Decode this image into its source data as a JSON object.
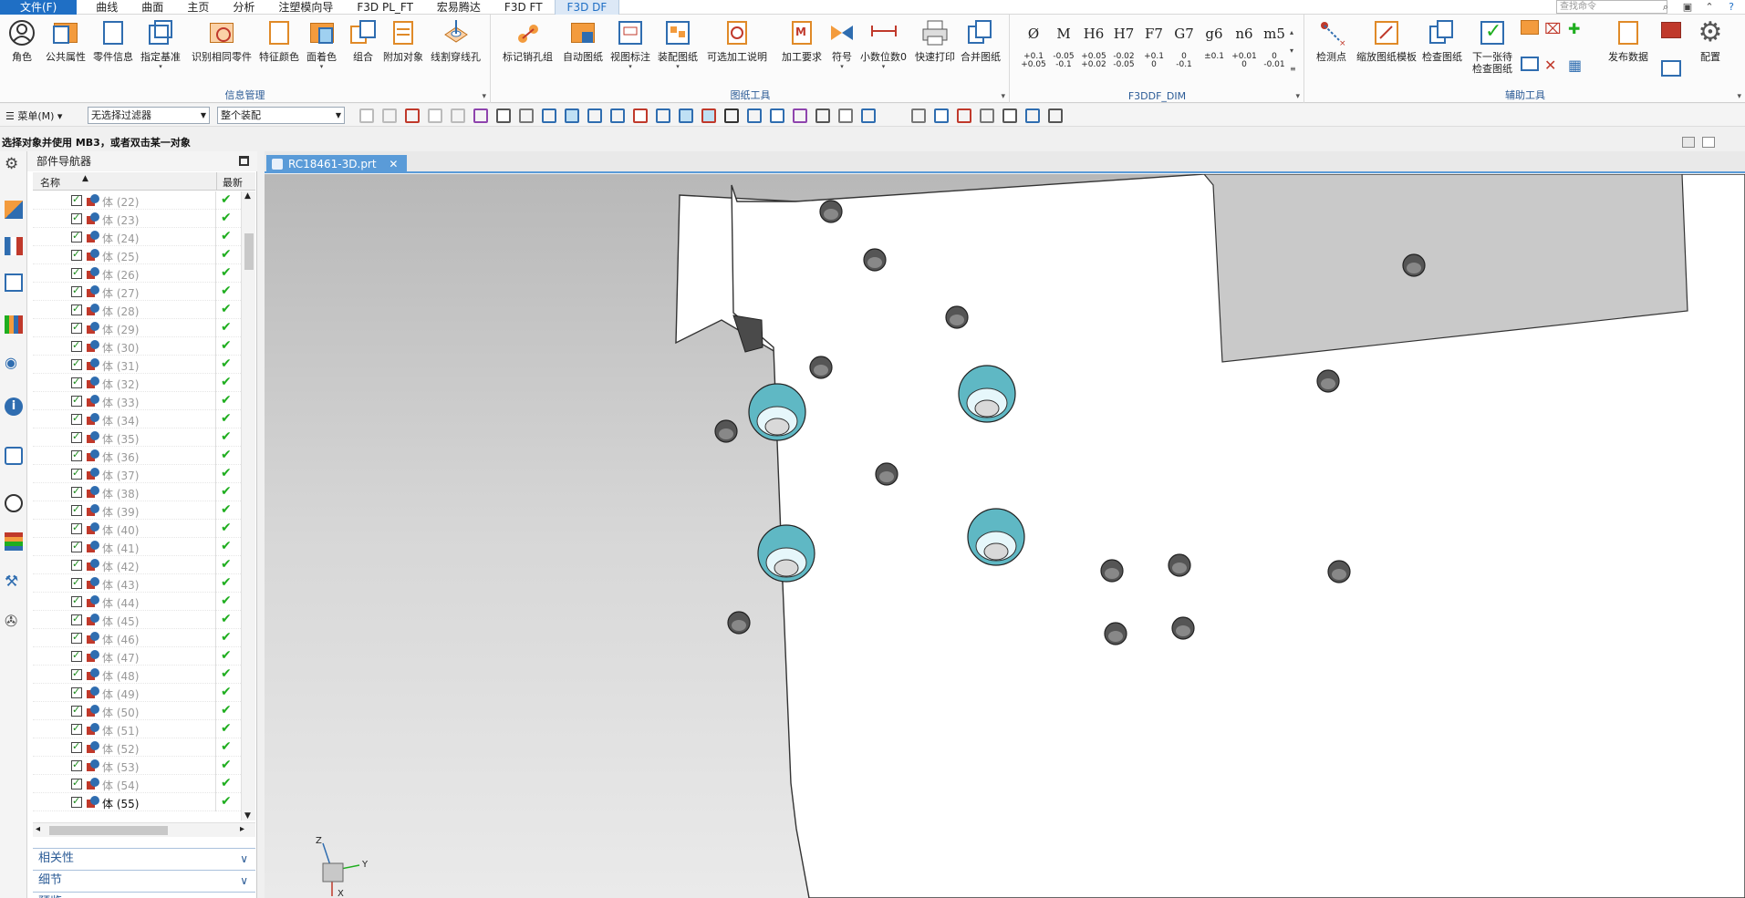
{
  "menu_tabs": [
    {
      "label": "文件(F)"
    },
    {
      "label": "曲线"
    },
    {
      "label": "曲面"
    },
    {
      "label": "主页"
    },
    {
      "label": "分析"
    },
    {
      "label": "注塑模向导"
    },
    {
      "label": "F3D PL_FT"
    },
    {
      "label": "宏易腾达"
    },
    {
      "label": "F3D FT"
    },
    {
      "label": "F3D DF"
    }
  ],
  "search_placeholder": "查找命令",
  "ribbon": {
    "group1_label": "信息管理",
    "group1_buttons": [
      "角色",
      "公共属性",
      "零件信息",
      "指定基准",
      "识别相同零件",
      "特征颜色",
      "面着色",
      "组合",
      "附加对象",
      "线割穿线孔"
    ],
    "group2_label": "图纸工具",
    "group2_buttons": [
      "标记销孔组",
      "自动图纸",
      "视图标注",
      "装配图纸",
      "可选加工说明",
      "加工要求",
      "符号",
      "小数位数0",
      "快速打印",
      "合并图纸"
    ],
    "group3_label": "F3DDF_DIM",
    "dims": [
      {
        "top": "Ø",
        "tol1": "+0.1",
        "tol2": "+0.05"
      },
      {
        "top": "M",
        "tol1": "-0.05",
        "tol2": "-0.1"
      },
      {
        "top": "H6",
        "tol1": "+0.05",
        "tol2": "+0.02"
      },
      {
        "top": "H7",
        "tol1": "-0.02",
        "tol2": "-0.05"
      },
      {
        "top": "F7",
        "tol1": "+0.1",
        "tol2": "0"
      },
      {
        "top": "G7",
        "tol1": "0",
        "tol2": "-0.1"
      },
      {
        "top": "g6",
        "tol1": "±0.1",
        "tol2": ""
      },
      {
        "top": "n6",
        "tol1": "+0.01",
        "tol2": "0"
      },
      {
        "top": "m5",
        "tol1": "0",
        "tol2": "-0.01"
      }
    ],
    "group4_label": "辅助工具",
    "group4_buttons": [
      "检测点",
      "缩放图纸模板",
      "检查图纸",
      "下一张待检查图纸",
      "发布数据",
      "配置"
    ]
  },
  "toolbar": {
    "menu_label": "菜单(M)",
    "filter_value": "无选择过滤器",
    "scope_value": "整个装配"
  },
  "prompt": "选择对象并使用 MB3，或者双击某一对象",
  "navigator": {
    "title": "部件导航器",
    "col_name": "名称",
    "col_latest": "最新",
    "rows": [
      "体 (22)",
      "体 (23)",
      "体 (24)",
      "体 (25)",
      "体 (26)",
      "体 (27)",
      "体 (28)",
      "体 (29)",
      "体 (30)",
      "体 (31)",
      "体 (32)",
      "体 (33)",
      "体 (34)",
      "体 (35)",
      "体 (36)",
      "体 (37)",
      "体 (38)",
      "体 (39)",
      "体 (40)",
      "体 (41)",
      "体 (42)",
      "体 (43)",
      "体 (44)",
      "体 (45)",
      "体 (46)",
      "体 (47)",
      "体 (48)",
      "体 (49)",
      "体 (50)",
      "体 (51)",
      "体 (52)",
      "体 (53)",
      "体 (54)",
      "体 (55)"
    ],
    "selected_row": "体 (55)",
    "section_dependencies": "相关性",
    "section_details": "细节",
    "section_preview": "预览"
  },
  "document_tab": "RC18461-3D.prt",
  "triad_labels": {
    "x": "X",
    "y": "Y",
    "z": "Z"
  },
  "colors": {
    "accent": "#1f6fc5",
    "active_tab": "#5a9bd8",
    "check_green": "#1fae1f",
    "plate_face": "#ffffff",
    "hole_cyan": "#5fb8c4"
  }
}
